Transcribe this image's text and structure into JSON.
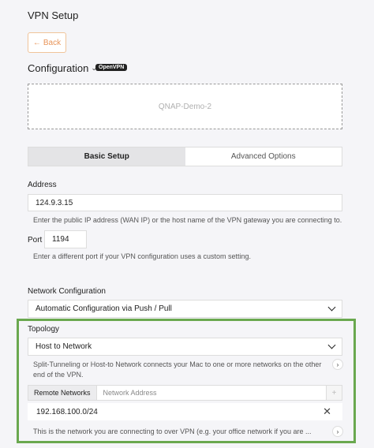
{
  "page": {
    "title": "VPN Setup"
  },
  "back_button": {
    "label": "Back"
  },
  "configuration": {
    "title": "Configuration",
    "badge": "OpenVPN",
    "profile_name": "QNAP-Demo-2"
  },
  "tabs": [
    {
      "label": "Basic Setup",
      "active": true
    },
    {
      "label": "Advanced Options",
      "active": false
    }
  ],
  "address": {
    "label": "Address",
    "value": "124.9.3.15",
    "help": "Enter the public IP address (WAN IP) or the host name of the VPN gateway you are connecting to."
  },
  "port": {
    "label": "Port",
    "value": "1194",
    "help": "Enter a different port if your VPN configuration uses a custom setting."
  },
  "network_configuration": {
    "label": "Network Configuration",
    "selected": "Automatic Configuration via Push / Pull"
  },
  "topology": {
    "label": "Topology",
    "selected": "Host to Network",
    "help": "Split-Tunneling or Host-to Network connects your Mac to one or more networks on the other end of the VPN."
  },
  "remote_networks": {
    "label": "Remote Networks",
    "placeholder": "Network Address",
    "add_symbol": "+",
    "entries": [
      "192.168.100.0/24"
    ],
    "help": "This is the network you are connecting to over VPN (e.g. your office network if you are ..."
  },
  "highlight_color": "#6aa84f",
  "accent_color": "#e8955a"
}
